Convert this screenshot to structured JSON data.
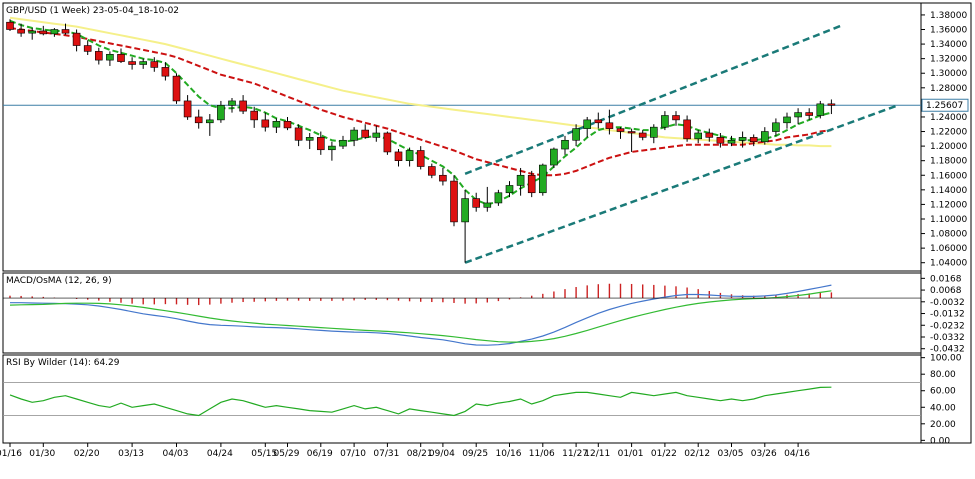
{
  "title": "GBP/USD (1 Week) 23-05-04_18-10-02",
  "current_price_label": "1.25607",
  "macd_label": "MACD/OsMA (12, 26, 9)",
  "rsi_label": "RSI By Wilder (14): 64.29",
  "colors": {
    "up_candle": "#22aa22",
    "down_candle": "#dd1111",
    "fast_ma": "#22aa22",
    "slow_ma": "#cc1111",
    "long_ma": "#f5f08a",
    "channel": "#1a7a78",
    "price_line": "#3c7ea6",
    "macd_line": "#4477cc",
    "signal_line": "#33bb33",
    "histogram": "#cc2222",
    "rsi_line": "#22aa22"
  },
  "chart_data": [
    {
      "type": "candlestick",
      "name": "price",
      "y_ticks": [
        "1.38000",
        "1.36000",
        "1.34000",
        "1.32000",
        "1.30000",
        "1.28000",
        "1.26000",
        "1.24000",
        "1.22000",
        "1.20000",
        "1.18000",
        "1.16000",
        "1.14000",
        "1.12000",
        "1.10000",
        "1.08000",
        "1.06000",
        "1.04000"
      ],
      "ylim": [
        1.03,
        1.395
      ],
      "x_ticks": [
        "01/16",
        "01/30",
        "02/20",
        "03/13",
        "04/03",
        "04/24",
        "05/15",
        "05/29",
        "06/19",
        "07/10",
        "07/31",
        "08/21",
        "09/04",
        "09/25",
        "10/16",
        "11/06",
        "11/27",
        "12/11",
        "01/01",
        "01/22",
        "02/12",
        "03/05",
        "03/26",
        "04/16"
      ],
      "x_tick_index": [
        0,
        3,
        7,
        11,
        15,
        19,
        23,
        25,
        28,
        31,
        34,
        37,
        39,
        42,
        45,
        48,
        51,
        53,
        56,
        59,
        62,
        65,
        68,
        71
      ],
      "candles": [
        [
          1.37,
          1.374,
          1.358,
          1.36
        ],
        [
          1.36,
          1.368,
          1.35,
          1.355
        ],
        [
          1.355,
          1.362,
          1.346,
          1.358
        ],
        [
          1.358,
          1.365,
          1.352,
          1.354
        ],
        [
          1.354,
          1.362,
          1.35,
          1.36
        ],
        [
          1.36,
          1.368,
          1.353,
          1.355
        ],
        [
          1.355,
          1.36,
          1.33,
          1.338
        ],
        [
          1.338,
          1.345,
          1.325,
          1.33
        ],
        [
          1.33,
          1.335,
          1.312,
          1.318
        ],
        [
          1.318,
          1.33,
          1.31,
          1.326
        ],
        [
          1.326,
          1.334,
          1.314,
          1.316
        ],
        [
          1.316,
          1.322,
          1.305,
          1.312
        ],
        [
          1.312,
          1.32,
          1.306,
          1.316
        ],
        [
          1.316,
          1.322,
          1.302,
          1.308
        ],
        [
          1.308,
          1.315,
          1.29,
          1.296
        ],
        [
          1.296,
          1.3,
          1.258,
          1.262
        ],
        [
          1.262,
          1.27,
          1.236,
          1.24
        ],
        [
          1.24,
          1.25,
          1.224,
          1.232
        ],
        [
          1.232,
          1.244,
          1.214,
          1.236
        ],
        [
          1.236,
          1.262,
          1.232,
          1.256
        ],
        [
          1.256,
          1.266,
          1.246,
          1.262
        ],
        [
          1.262,
          1.27,
          1.244,
          1.248
        ],
        [
          1.248,
          1.254,
          1.225,
          1.236
        ],
        [
          1.236,
          1.246,
          1.22,
          1.226
        ],
        [
          1.226,
          1.238,
          1.218,
          1.234
        ],
        [
          1.234,
          1.24,
          1.222,
          1.225
        ],
        [
          1.225,
          1.23,
          1.2,
          1.208
        ],
        [
          1.208,
          1.218,
          1.196,
          1.212
        ],
        [
          1.212,
          1.22,
          1.188,
          1.195
        ],
        [
          1.195,
          1.206,
          1.18,
          1.2
        ],
        [
          1.2,
          1.214,
          1.196,
          1.208
        ],
        [
          1.208,
          1.226,
          1.2,
          1.222
        ],
        [
          1.222,
          1.23,
          1.21,
          1.212
        ],
        [
          1.212,
          1.228,
          1.206,
          1.218
        ],
        [
          1.218,
          1.22,
          1.188,
          1.192
        ],
        [
          1.192,
          1.196,
          1.172,
          1.18
        ],
        [
          1.18,
          1.198,
          1.172,
          1.194
        ],
        [
          1.194,
          1.2,
          1.168,
          1.172
        ],
        [
          1.172,
          1.176,
          1.156,
          1.16
        ],
        [
          1.16,
          1.17,
          1.146,
          1.152
        ],
        [
          1.152,
          1.16,
          1.09,
          1.096
        ],
        [
          1.096,
          1.14,
          1.04,
          1.128
        ],
        [
          1.128,
          1.136,
          1.11,
          1.116
        ],
        [
          1.116,
          1.144,
          1.11,
          1.122
        ],
        [
          1.122,
          1.14,
          1.118,
          1.136
        ],
        [
          1.136,
          1.152,
          1.13,
          1.146
        ],
        [
          1.146,
          1.17,
          1.132,
          1.16
        ],
        [
          1.16,
          1.166,
          1.13,
          1.136
        ],
        [
          1.136,
          1.176,
          1.132,
          1.174
        ],
        [
          1.174,
          1.198,
          1.17,
          1.196
        ],
        [
          1.196,
          1.214,
          1.188,
          1.208
        ],
        [
          1.208,
          1.23,
          1.2,
          1.224
        ],
        [
          1.224,
          1.24,
          1.212,
          1.236
        ],
        [
          1.236,
          1.246,
          1.224,
          1.232
        ],
        [
          1.232,
          1.25,
          1.216,
          1.224
        ],
        [
          1.224,
          1.226,
          1.21,
          1.22
        ],
        [
          1.22,
          1.224,
          1.192,
          1.218
        ],
        [
          1.218,
          1.222,
          1.208,
          1.212
        ],
        [
          1.212,
          1.23,
          1.204,
          1.226
        ],
        [
          1.226,
          1.248,
          1.222,
          1.242
        ],
        [
          1.242,
          1.248,
          1.228,
          1.236
        ],
        [
          1.236,
          1.242,
          1.206,
          1.21
        ],
        [
          1.21,
          1.222,
          1.204,
          1.218
        ],
        [
          1.218,
          1.224,
          1.206,
          1.212
        ],
        [
          1.212,
          1.218,
          1.198,
          1.204
        ],
        [
          1.204,
          1.214,
          1.2,
          1.208
        ],
        [
          1.208,
          1.22,
          1.198,
          1.212
        ],
        [
          1.212,
          1.216,
          1.2,
          1.206
        ],
        [
          1.206,
          1.226,
          1.202,
          1.22
        ],
        [
          1.22,
          1.238,
          1.214,
          1.232
        ],
        [
          1.232,
          1.246,
          1.224,
          1.24
        ],
        [
          1.24,
          1.252,
          1.23,
          1.246
        ],
        [
          1.246,
          1.252,
          1.236,
          1.242
        ],
        [
          1.242,
          1.262,
          1.238,
          1.258
        ],
        [
          1.258,
          1.264,
          1.244,
          1.256
        ]
      ],
      "ma_fast": [
        1.372,
        1.366,
        1.362,
        1.36,
        1.358,
        1.358,
        1.354,
        1.346,
        1.338,
        1.332,
        1.328,
        1.324,
        1.32,
        1.318,
        1.314,
        1.3,
        1.284,
        1.268,
        1.256,
        1.252,
        1.252,
        1.254,
        1.252,
        1.246,
        1.238,
        1.234,
        1.228,
        1.222,
        1.215,
        1.208,
        1.206,
        1.208,
        1.212,
        1.214,
        1.21,
        1.202,
        1.194,
        1.188,
        1.18,
        1.172,
        1.16,
        1.14,
        1.126,
        1.12,
        1.124,
        1.132,
        1.142,
        1.15,
        1.158,
        1.172,
        1.186,
        1.198,
        1.212,
        1.222,
        1.226,
        1.226,
        1.224,
        1.222,
        1.222,
        1.226,
        1.23,
        1.228,
        1.222,
        1.218,
        1.214,
        1.21,
        1.208,
        1.208,
        1.21,
        1.214,
        1.222,
        1.23,
        1.236,
        1.242,
        1.246
      ],
      "ma_slow": [
        1.362,
        1.36,
        1.358,
        1.356,
        1.354,
        1.352,
        1.35,
        1.347,
        1.344,
        1.341,
        1.338,
        1.335,
        1.332,
        1.329,
        1.326,
        1.322,
        1.316,
        1.31,
        1.304,
        1.298,
        1.294,
        1.29,
        1.286,
        1.28,
        1.274,
        1.268,
        1.262,
        1.256,
        1.25,
        1.245,
        1.24,
        1.236,
        1.232,
        1.228,
        1.224,
        1.219,
        1.214,
        1.209,
        1.204,
        1.199,
        1.194,
        1.188,
        1.182,
        1.178,
        1.174,
        1.17,
        1.166,
        1.162,
        1.16,
        1.16,
        1.162,
        1.166,
        1.172,
        1.178,
        1.184,
        1.188,
        1.192,
        1.194,
        1.196,
        1.198,
        1.2,
        1.202,
        1.202,
        1.202,
        1.202,
        1.202,
        1.202,
        1.204,
        1.206,
        1.208,
        1.212,
        1.214,
        1.216,
        1.22,
        1.222
      ],
      "ma_long": [
        1.376,
        1.374,
        1.372,
        1.37,
        1.368,
        1.366,
        1.364,
        1.361,
        1.358,
        1.355,
        1.352,
        1.349,
        1.346,
        1.343,
        1.34,
        1.336,
        1.332,
        1.328,
        1.324,
        1.32,
        1.316,
        1.312,
        1.308,
        1.304,
        1.3,
        1.296,
        1.292,
        1.288,
        1.284,
        1.28,
        1.276,
        1.273,
        1.27,
        1.267,
        1.264,
        1.261,
        1.258,
        1.256,
        1.254,
        1.252,
        1.25,
        1.248,
        1.246,
        1.244,
        1.242,
        1.24,
        1.238,
        1.236,
        1.234,
        1.232,
        1.23,
        1.228,
        1.226,
        1.224,
        1.222,
        1.22,
        1.218,
        1.216,
        1.214,
        1.212,
        1.211,
        1.21,
        1.209,
        1.208,
        1.207,
        1.206,
        1.205,
        1.204,
        1.203,
        1.202,
        1.202,
        1.201,
        1.201,
        1.2,
        1.2
      ],
      "channel_upper": [
        [
          41,
          1.162
        ],
        [
          75,
          1.366
        ]
      ],
      "channel_lower": [
        [
          41,
          1.04
        ],
        [
          80,
          1.256
        ]
      ],
      "current_price": 1.25607
    },
    {
      "type": "bar+line",
      "name": "MACD/OsMA (12, 26, 9)",
      "y_ticks": [
        "0.0168",
        "0.0068",
        "-0.0032",
        "-0.0132",
        "-0.0232",
        "-0.0332",
        "-0.0432"
      ],
      "ylim": [
        -0.046,
        0.0205
      ],
      "macd": [
        -0.004,
        -0.004,
        -0.0042,
        -0.0044,
        -0.0046,
        -0.0048,
        -0.0052,
        -0.0058,
        -0.0068,
        -0.0082,
        -0.0098,
        -0.0116,
        -0.0134,
        -0.0148,
        -0.016,
        -0.0176,
        -0.0196,
        -0.0214,
        -0.0226,
        -0.0232,
        -0.0236,
        -0.024,
        -0.0246,
        -0.025,
        -0.0252,
        -0.0256,
        -0.0262,
        -0.027,
        -0.0276,
        -0.0282,
        -0.0286,
        -0.029,
        -0.0292,
        -0.0296,
        -0.0302,
        -0.0312,
        -0.0324,
        -0.0336,
        -0.0346,
        -0.0356,
        -0.0372,
        -0.039,
        -0.04,
        -0.0402,
        -0.0398,
        -0.0388,
        -0.037,
        -0.035,
        -0.0324,
        -0.029,
        -0.025,
        -0.0208,
        -0.0168,
        -0.013,
        -0.0098,
        -0.007,
        -0.0046,
        -0.0026,
        -0.0008,
        0.0008,
        0.0022,
        0.003,
        0.003,
        0.0026,
        0.002,
        0.0016,
        0.0014,
        0.0014,
        0.0018,
        0.0026,
        0.004,
        0.0056,
        0.0074,
        0.0092,
        0.011
      ],
      "signal": [
        -0.006,
        -0.0058,
        -0.0056,
        -0.0054,
        -0.005,
        -0.0046,
        -0.0044,
        -0.0044,
        -0.0046,
        -0.005,
        -0.0058,
        -0.0068,
        -0.008,
        -0.0094,
        -0.0108,
        -0.0122,
        -0.0138,
        -0.0154,
        -0.017,
        -0.0184,
        -0.0196,
        -0.0206,
        -0.0214,
        -0.0222,
        -0.0228,
        -0.0234,
        -0.024,
        -0.0246,
        -0.0252,
        -0.0258,
        -0.0264,
        -0.027,
        -0.0276,
        -0.028,
        -0.0284,
        -0.029,
        -0.0296,
        -0.0304,
        -0.0312,
        -0.032,
        -0.033,
        -0.0342,
        -0.0354,
        -0.0364,
        -0.0372,
        -0.0376,
        -0.0376,
        -0.037,
        -0.036,
        -0.0346,
        -0.0326,
        -0.0302,
        -0.0276,
        -0.0248,
        -0.022,
        -0.0192,
        -0.0166,
        -0.0142,
        -0.012,
        -0.0098,
        -0.0078,
        -0.006,
        -0.0046,
        -0.0034,
        -0.0024,
        -0.0016,
        -0.001,
        -0.0006,
        -0.0002,
        0.0004,
        0.0012,
        0.0022,
        0.0034,
        0.0048,
        0.0062
      ],
      "histogram": [
        0.002,
        0.0018,
        0.0014,
        0.001,
        0.0004,
        -0.0002,
        -0.0008,
        -0.0014,
        -0.0022,
        -0.0032,
        -0.004,
        -0.0048,
        -0.0054,
        -0.0054,
        -0.0052,
        -0.0054,
        -0.0058,
        -0.006,
        -0.0056,
        -0.0048,
        -0.004,
        -0.0034,
        -0.0032,
        -0.0028,
        -0.0024,
        -0.0022,
        -0.0022,
        -0.0024,
        -0.0024,
        -0.0024,
        -0.0022,
        -0.002,
        -0.0016,
        -0.0016,
        -0.0018,
        -0.0022,
        -0.0028,
        -0.0032,
        -0.0034,
        -0.0036,
        -0.0042,
        -0.0048,
        -0.0046,
        -0.0038,
        -0.0026,
        -0.0012,
        0.0006,
        0.002,
        0.0036,
        0.0056,
        0.0076,
        0.0094,
        0.0108,
        0.0118,
        0.0122,
        0.0122,
        0.012,
        0.0116,
        0.0112,
        0.0106,
        0.01,
        0.009,
        0.0076,
        0.006,
        0.0044,
        0.0032,
        0.0024,
        0.002,
        0.002,
        0.0022,
        0.0028,
        0.0034,
        0.004,
        0.0044,
        0.0048
      ]
    },
    {
      "type": "line",
      "name": "RSI By Wilder (14): 64.29",
      "y_ticks": [
        "100.00",
        "80.00",
        "60.00",
        "40.00",
        "20.00",
        "0.00"
      ],
      "ylim": [
        -2,
        102
      ],
      "levels": [
        70,
        30
      ],
      "values": [
        55,
        50,
        46,
        48,
        52,
        54,
        50,
        46,
        42,
        40,
        45,
        40,
        42,
        44,
        40,
        36,
        32,
        30,
        38,
        46,
        50,
        48,
        44,
        40,
        42,
        40,
        38,
        36,
        35,
        34,
        38,
        42,
        38,
        40,
        36,
        32,
        38,
        36,
        34,
        32,
        30,
        35,
        44,
        42,
        45,
        47,
        50,
        44,
        48,
        54,
        56,
        58,
        58,
        56,
        54,
        52,
        58,
        56,
        54,
        56,
        58,
        54,
        52,
        50,
        48,
        50,
        48,
        50,
        54,
        56,
        58,
        60,
        62,
        64,
        64.29
      ]
    }
  ]
}
